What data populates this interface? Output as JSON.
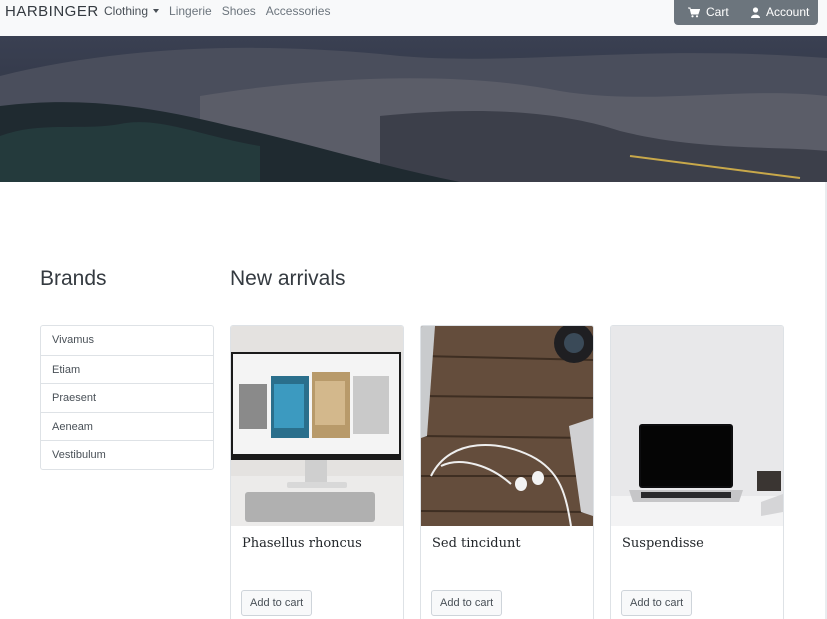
{
  "navbar": {
    "brand": "HARBINGER",
    "links": [
      {
        "label": "Clothing",
        "has_dropdown": true
      },
      {
        "label": "Lingerie"
      },
      {
        "label": "Shoes"
      },
      {
        "label": "Accessories"
      }
    ],
    "cart_label": "Cart",
    "account_label": "Account",
    "cart_icon": "shopping-cart-icon",
    "account_icon": "user-icon"
  },
  "brands": {
    "heading": "Brands",
    "items": [
      "Vivamus",
      "Etiam",
      "Praesent",
      "Aeneam",
      "Vestibulum"
    ]
  },
  "arrivals": {
    "heading": "New arrivals",
    "products": [
      {
        "title": "Phasellus rhoncus",
        "button": "Add to cart"
      },
      {
        "title": "Sed tincidunt",
        "button": "Add to cart"
      },
      {
        "title": "Suspendisse",
        "button": "Add to cart"
      }
    ]
  },
  "colors": {
    "navbar_bg": "#f8f9fa",
    "action_bg": "#6c757d",
    "border": "#dee2e6"
  }
}
